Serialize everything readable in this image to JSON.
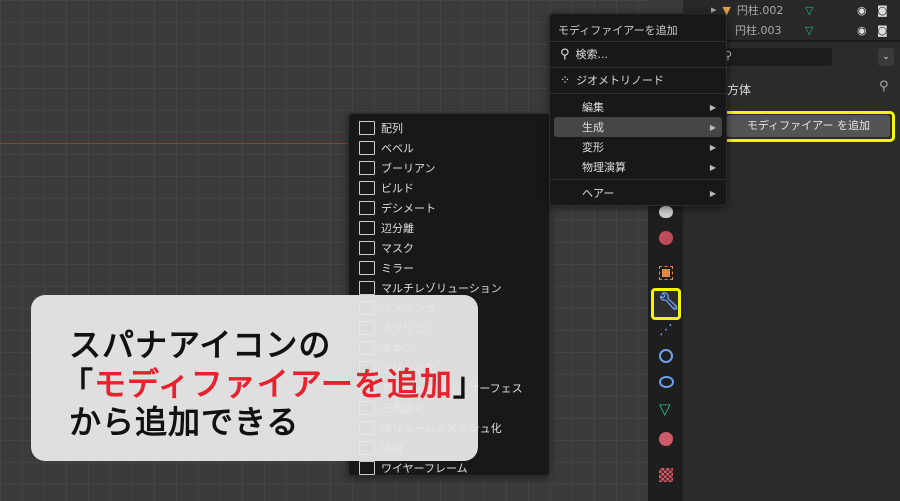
{
  "outliner": {
    "rows": [
      {
        "name": "円柱.002"
      },
      {
        "name": "円柱.003"
      }
    ]
  },
  "properties": {
    "object_name_partial": "方体",
    "add_modifier_button": "モディファイアー を追加"
  },
  "main_menu": {
    "title": "モディファイアーを追加",
    "search": "検索...",
    "geometry_nodes": "ジオメトリノード",
    "items": [
      {
        "label": "編集"
      },
      {
        "label": "生成",
        "active": true
      },
      {
        "label": "変形"
      },
      {
        "label": "物理演算"
      },
      {
        "label": "ヘアー"
      }
    ]
  },
  "generate_menu": {
    "items": [
      "配列",
      "ベベル",
      "ブーリアン",
      "ビルド",
      "デシメート",
      "辺分離",
      "マスク",
      "ミラー",
      "マルチレゾリューション",
      "リメッシュ",
      "スクリュー",
      "スキン",
      "ソリッド化",
      "サブディビジョンサーフェス",
      "三角面化",
      "ボリュームのメッシュ化",
      "溶接",
      "ワイヤーフレーム"
    ]
  },
  "callout": {
    "line1": "スパナアイコンの",
    "line2_open": "「",
    "line2_highlight": "モディファイアーを追加",
    "line2_close": "」",
    "line3": "から追加できる"
  },
  "colors": {
    "highlight": "#f5f500",
    "callout_red": "#e8222c",
    "wrench": "#6ea0f0"
  },
  "property_tabs": [
    "physics",
    "world",
    "object",
    "modifier",
    "particles",
    "physics-force",
    "constraints",
    "data",
    "material",
    "texture"
  ]
}
